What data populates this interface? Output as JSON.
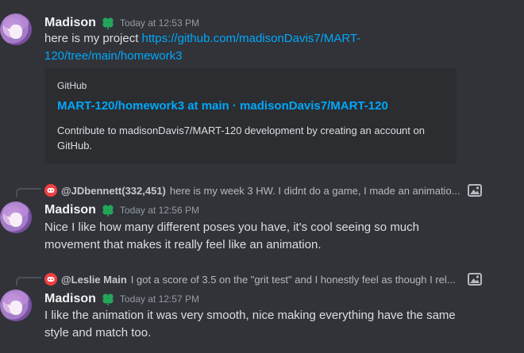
{
  "messages": [
    {
      "author": "Madison",
      "timestamp": "Today at 12:53 PM",
      "text_prefix": "here is my project ",
      "link_line1": "https://github.com/madisonDavis7/MART-",
      "link_line2": "120/tree/main/homework3",
      "embed": {
        "provider": "GitHub",
        "title": "MART-120/homework3 at main · madisonDavis7/MART-120",
        "description": "Contribute to madisonDavis7/MART-120 development by creating an account on GitHub."
      }
    },
    {
      "reply": {
        "author": "@JDbennett(332,451)",
        "text": "here is my week 3 HW. I didnt do a game, I made an animatio..."
      },
      "author": "Madison",
      "timestamp": "Today at 12:56 PM",
      "text": "Nice I like how many different poses you have, it's cool seeing so much movement that makes it really feel like an animation."
    },
    {
      "reply": {
        "author": "@Leslie Main",
        "text": "I got a score of 3.5 on the \"grit test\" and I honestly feel as though I rel..."
      },
      "author": "Madison",
      "timestamp": "Today at 12:57 PM",
      "text": "I like the animation it was very smooth, nice making everything have the same style and match too."
    }
  ],
  "icons": {
    "role_badge": "clover-icon",
    "reply_avatar": "discord-icon",
    "attachment": "image-icon"
  },
  "colors": {
    "background": "#313338",
    "link": "#00a8fc",
    "embed_bg": "#2b2d31",
    "badge": "#23a55a",
    "reply_avatar": "#f23f43"
  }
}
